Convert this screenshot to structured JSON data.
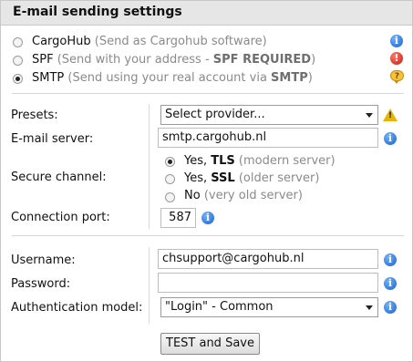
{
  "header": {
    "title": "E-mail sending settings"
  },
  "send_modes": [
    {
      "name": "CargoHub",
      "desc": "(Send as Cargohub software)"
    },
    {
      "name": "SPF",
      "desc_pre": "(Send with your address - ",
      "desc_bold": "SPF REQUIRED",
      "desc_post": ")"
    },
    {
      "name": "SMTP",
      "desc_pre": "(Send using your real account via ",
      "desc_bold": "SMTP",
      "desc_post": ")"
    }
  ],
  "selected_mode": "SMTP",
  "form": {
    "presets_label": "Presets:",
    "presets_value": "Select provider...",
    "server_label": "E-mail server:",
    "server_value": "smtp.cargohub.nl",
    "secure_label": "Secure channel:",
    "secure_options": [
      {
        "prefix": "Yes, ",
        "bold": "TLS",
        "desc": "(modern server)"
      },
      {
        "prefix": "Yes, ",
        "bold": "SSL",
        "desc": "(older server)"
      },
      {
        "prefix": "No",
        "bold": "",
        "desc": "(very old server)"
      }
    ],
    "secure_selected": "TLS",
    "port_label": "Connection port:",
    "port_value": "587",
    "username_label": "Username:",
    "username_value": "chsupport@cargohub.nl",
    "password_label": "Password:",
    "password_value": "",
    "auth_label": "Authentication model:",
    "auth_value": "\"Login\" - Common",
    "test_button": "TEST and Save"
  },
  "icons": {
    "info": "info-icon",
    "error": "error-icon",
    "chat": "chat-bubble-icon",
    "warning": "warning-icon"
  },
  "colors": {
    "header_bg": "#e6e6e6",
    "info_blue": "#1b63c8",
    "error_red": "#c81b12",
    "warning_yellow": "#e8b400",
    "muted_text": "#8a8a8a"
  }
}
